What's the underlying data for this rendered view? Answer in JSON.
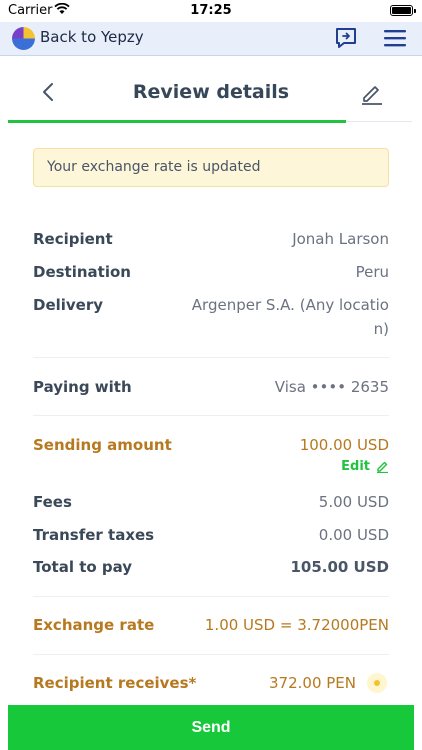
{
  "status_bar": {
    "carrier": "Carrier",
    "time": "17:25"
  },
  "app_bar": {
    "back_label": "Back to Yepzy"
  },
  "nav": {
    "title": "Review details"
  },
  "notice": {
    "text": "Your exchange rate is updated"
  },
  "details": {
    "recipient": {
      "label": "Recipient",
      "value": "Jonah Larson"
    },
    "destination": {
      "label": "Destination",
      "value": "Peru"
    },
    "delivery": {
      "label": "Delivery",
      "value_line1": "Argenper S.A. (Any locatio",
      "value_line2": "n)"
    },
    "paying_with": {
      "label": "Paying with",
      "value": "Visa •••• 2635"
    },
    "sending_amount": {
      "label": "Sending amount",
      "value": "100.00 USD",
      "edit_label": "Edit"
    },
    "fees": {
      "label": "Fees",
      "value": "5.00 USD"
    },
    "transfer_taxes": {
      "label": "Transfer taxes",
      "value": "0.00 USD"
    },
    "total": {
      "label": "Total to pay",
      "value": "105.00 USD"
    },
    "exchange_rate": {
      "label": "Exchange rate",
      "value": "1.00 USD = 3.72000PEN"
    },
    "recipient_receives": {
      "label": "Recipient receives*",
      "value": "372.00 PEN"
    }
  },
  "send_button": {
    "label": "Send"
  },
  "colors": {
    "accent": "#18c83b",
    "gold": "#b7791f",
    "notice_bg": "#fdf6d8"
  },
  "icons": [
    "wifi-icon",
    "battery-icon",
    "yepzy-logo-icon",
    "feedback-icon",
    "menu-icon",
    "chevron-left-icon",
    "pencil-icon",
    "coin-icon"
  ]
}
